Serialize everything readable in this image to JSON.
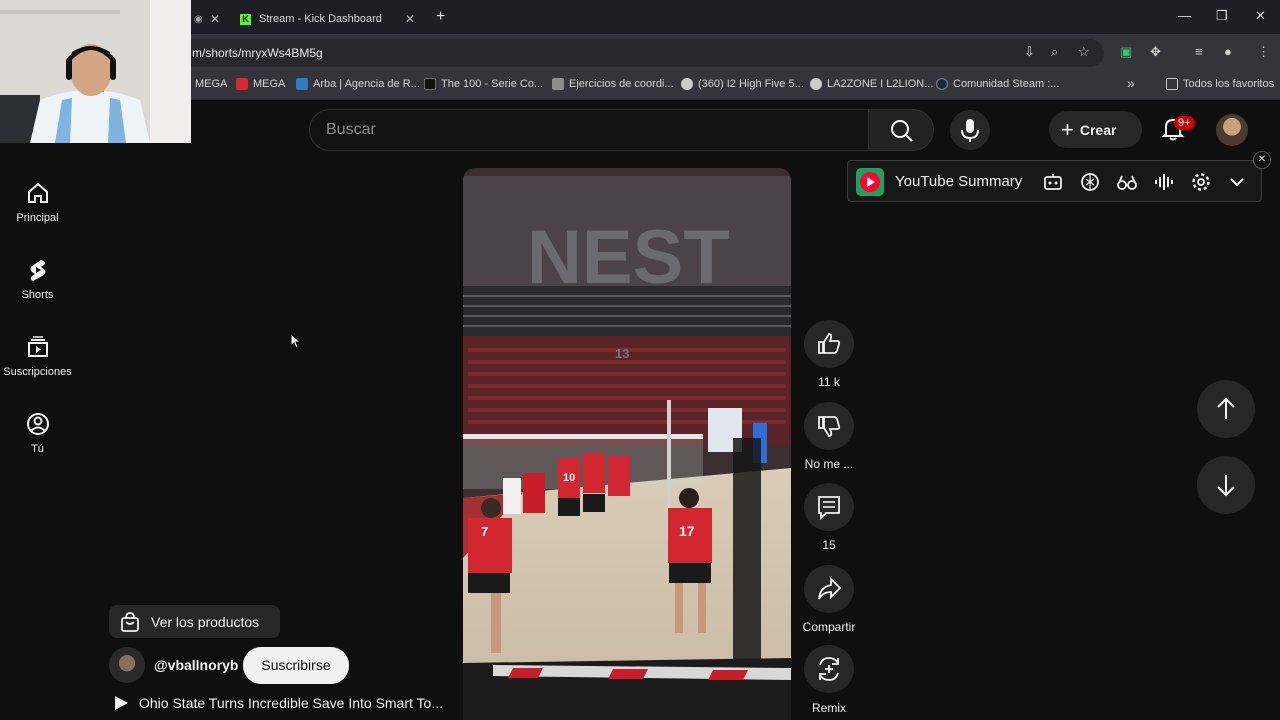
{
  "browser": {
    "tabs": [
      {
        "label": "",
        "close": "✕"
      },
      {
        "label": "Stream - Kick Dashboard",
        "close": "✕"
      }
    ],
    "new_tab": "+",
    "url": "m/shorts/mryxWs4BM5g",
    "window_controls": {
      "minimize": "—",
      "restore": "❐",
      "close": "✕"
    },
    "bookmarks": [
      {
        "label": "MEGA",
        "color": "#d9272e"
      },
      {
        "label": "MEGA",
        "color": "#d9272e"
      },
      {
        "label": "Arba | Agencia de R...",
        "color": "#2f7cc4"
      },
      {
        "label": "The 100 - Serie Co...",
        "color": "#111111"
      },
      {
        "label": "Ejercicios de coordi...",
        "color": "#8c8c8c"
      },
      {
        "label": "(360) I2 High Five 5...",
        "color": "#cccccc"
      },
      {
        "label": "LA2ZONE I L2LION...",
        "color": "#cccccc"
      },
      {
        "label": "Comunidad Steam :...",
        "color": "#1b2838"
      }
    ],
    "bookmarks_more": "»",
    "all_favorites": "Todos los favoritos"
  },
  "youtube": {
    "search_placeholder": "Buscar",
    "create_label": "Crear",
    "notifications_badge": "9+",
    "nav": [
      {
        "label": "Principal",
        "icon": "home-icon"
      },
      {
        "label": "Shorts",
        "icon": "shorts-icon"
      },
      {
        "label": "Suscripciones",
        "icon": "subscriptions-icon"
      },
      {
        "label": "Tú",
        "icon": "account-icon"
      }
    ],
    "summary_title": "YouTube Summary",
    "summary_close": "✕",
    "actions": {
      "like_count": "11 k",
      "dislike_label": "No me ...",
      "comment_count": "15",
      "share_label": "Compartir",
      "remix_label": "Remix"
    },
    "video": {
      "arena_text": "NEST",
      "jersey_numbers": [
        "13",
        "17",
        "7",
        "10"
      ]
    },
    "products_label": "Ver los productos",
    "channel_name": "@vballnoryb",
    "subscribe_label": "Suscribirse",
    "video_title": "Ohio State Turns Incredible Save Into Smart To..."
  },
  "colors": {
    "accent": "#cc0000",
    "background": "#0f0f0f",
    "summary_red": "#ff0033"
  }
}
